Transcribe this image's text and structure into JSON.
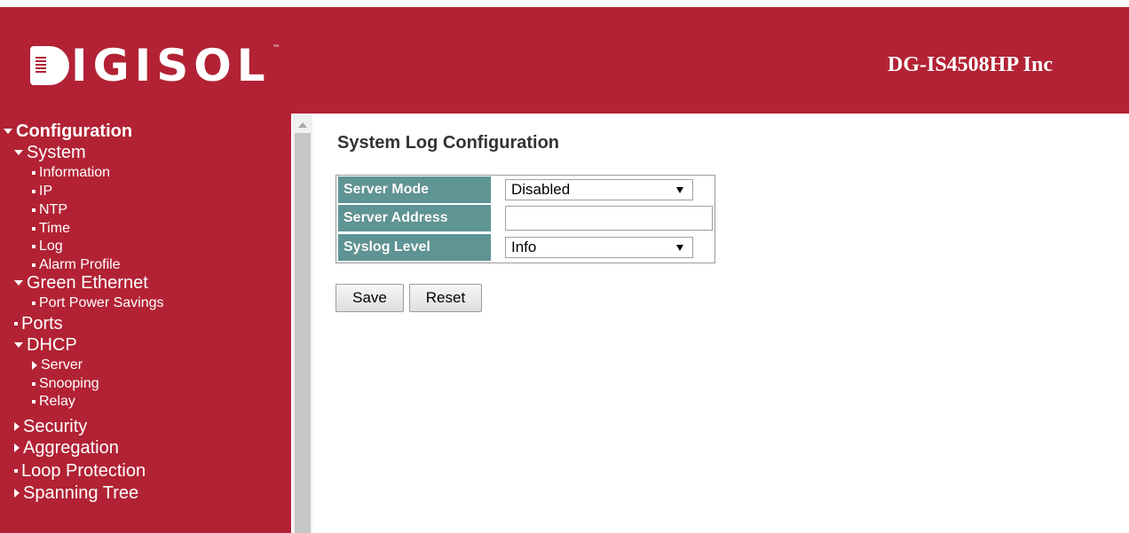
{
  "brand": {
    "logo_text": "IGISOL",
    "trademark": "™"
  },
  "header": {
    "device_title": "DG-IS4508HP Inc"
  },
  "sidebar": {
    "items": [
      {
        "label": "Configuration",
        "marker": "triangle-down"
      },
      {
        "label": "System",
        "marker": "triangle-down"
      },
      {
        "label": "Information",
        "marker": "square"
      },
      {
        "label": "IP",
        "marker": "square"
      },
      {
        "label": "NTP",
        "marker": "square"
      },
      {
        "label": "Time",
        "marker": "square"
      },
      {
        "label": "Log",
        "marker": "square"
      },
      {
        "label": "Alarm Profile",
        "marker": "square"
      },
      {
        "label": "Green Ethernet",
        "marker": "triangle-down"
      },
      {
        "label": "Port Power Savings",
        "marker": "square"
      },
      {
        "label": "Ports",
        "marker": "square"
      },
      {
        "label": "DHCP",
        "marker": "triangle-down"
      },
      {
        "label": "Server",
        "marker": "triangle-right"
      },
      {
        "label": "Snooping",
        "marker": "square"
      },
      {
        "label": "Relay",
        "marker": "square"
      },
      {
        "label": "Security",
        "marker": "triangle-right"
      },
      {
        "label": "Aggregation",
        "marker": "triangle-right"
      },
      {
        "label": "Loop Protection",
        "marker": "square"
      },
      {
        "label": "Spanning Tree",
        "marker": "triangle-right"
      }
    ]
  },
  "main": {
    "title": "System Log Configuration",
    "form": {
      "server_mode": {
        "label": "Server Mode",
        "value": "Disabled"
      },
      "server_address": {
        "label": "Server Address",
        "value": ""
      },
      "syslog_level": {
        "label": "Syslog Level",
        "value": "Info"
      }
    },
    "buttons": {
      "save": "Save",
      "reset": "Reset"
    }
  },
  "colors": {
    "brand_red": "#b22234",
    "label_teal": "#5f9494"
  }
}
